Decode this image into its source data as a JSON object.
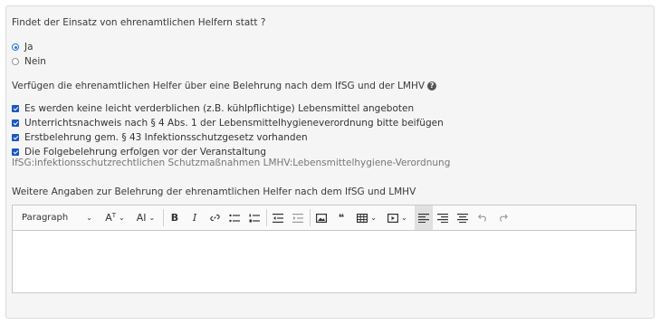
{
  "question1": {
    "label": "Findet der Einsatz von ehrenamtlichen Helfern statt ?",
    "options": [
      {
        "label": "Ja",
        "checked": true
      },
      {
        "label": "Nein",
        "checked": false
      }
    ]
  },
  "question2": {
    "label": "Verfügen die ehrenamtlichen Helfer über eine Belehrung nach dem IfSG und der LMHV",
    "help_icon": "question-circle-icon",
    "checkboxes": [
      {
        "label": "Es werden keine leicht verderblichen (z.B. kühlpflichtige) Lebensmittel angeboten",
        "checked": true
      },
      {
        "label": "Unterrichtsnachweis nach § 4 Abs. 1 der Lebensmittelhygieneverordnung bitte beifügen",
        "checked": true
      },
      {
        "label": "Erstbelehrung gem. § 43 Infektionsschutzgesetz vorhanden",
        "checked": true
      },
      {
        "label": "Die Folgebelehrung erfolgen vor der Veranstaltung",
        "checked": true
      }
    ],
    "hint": "IfSG:infektionsschutzrechtlichen Schutzmaßnahmen LMHV:Lebensmittelhygiene-Verordnung"
  },
  "question3": {
    "label": "Weitere Angaben zur Belehrung der ehrenamtlichen Helfer nach dem IfSG und LMHV"
  },
  "toolbar": {
    "paragraph": "Paragraph",
    "font_size_glyph": "A",
    "font_family_glyph": "AI",
    "bold": "B",
    "italic": "I",
    "blockquote": "❝"
  },
  "colors": {
    "accent": "#1a73e8",
    "checkbox": "#1a56c4"
  }
}
